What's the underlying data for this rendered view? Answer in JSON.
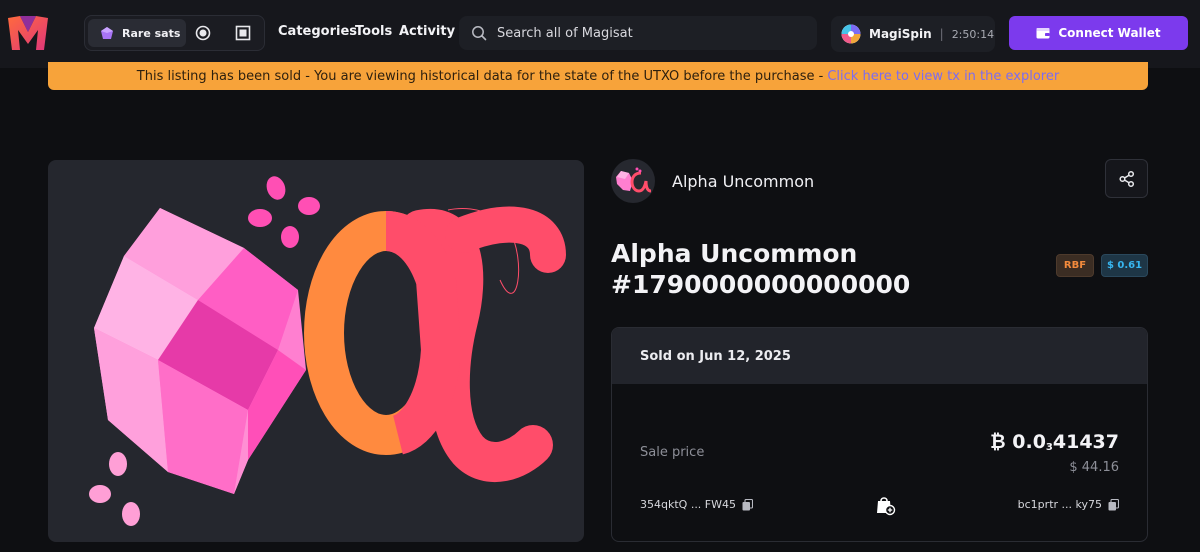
{
  "header": {
    "rare_sats_label": "Rare sats",
    "nav": [
      "Categories",
      "Tools",
      "Activity"
    ],
    "search_placeholder": "Search all of Magisat",
    "magispin_label": "MagiSpin",
    "magispin_separator": "|",
    "magispin_timer": "2:50:14",
    "connect_label": "Connect Wallet"
  },
  "banner": {
    "text": "This listing has been sold - You are viewing historical data for the state of the UTXO before the purchase -",
    "link": "Click here to view tx in the explorer"
  },
  "collection": {
    "name": "Alpha Uncommon"
  },
  "item": {
    "title_line1": "Alpha Uncommon",
    "title_line2": "#1790000000000000",
    "badge_rbf": "RBF",
    "badge_fee": "$ 0.61"
  },
  "sale": {
    "sold_on": "Sold on Jun 12, 2025",
    "price_label": "Sale price",
    "btc_prefix": "₿ 0.0",
    "btc_sub": "3",
    "btc_digits": "41437",
    "usd": "$ 44.16",
    "from_address": "354qktQ ... FW45",
    "to_address": "bc1prtr ... ky75"
  },
  "colors": {
    "accent": "#7c3aed",
    "banner": "#f7a33a",
    "rbf": "#f28a3c",
    "fee": "#37b6f0"
  },
  "icons": [
    "magisat-logo",
    "gem-icon",
    "circle-filter-icon",
    "square-filter-icon",
    "search-icon",
    "magispin-icon",
    "wallet-icon",
    "share-icon",
    "copy-icon",
    "bag-icon"
  ]
}
